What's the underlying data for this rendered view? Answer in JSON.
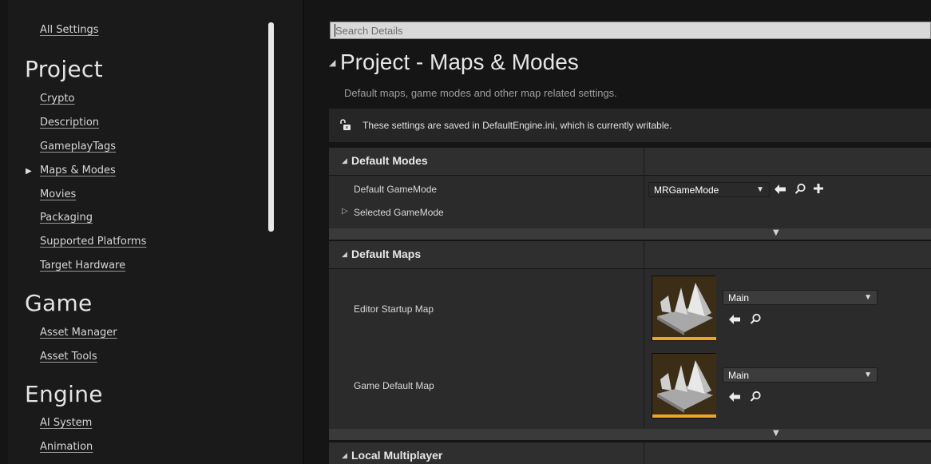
{
  "nav": {
    "top_link": "All Settings",
    "sections": [
      {
        "heading": "Project",
        "items": [
          "Crypto",
          "Description",
          "GameplayTags",
          "Maps & Modes",
          "Movies",
          "Packaging",
          "Supported Platforms",
          "Target Hardware"
        ],
        "selected": "Maps & Modes"
      },
      {
        "heading": "Game",
        "items": [
          "Asset Manager",
          "Asset Tools"
        ]
      },
      {
        "heading": "Engine",
        "items": [
          "AI System",
          "Animation"
        ]
      }
    ]
  },
  "search": {
    "placeholder": "Search Details"
  },
  "page": {
    "title": "Project - Maps & Modes",
    "description": "Default maps, game modes and other map related settings.",
    "writable_notice": "These settings are saved in DefaultEngine.ini, which is currently writable."
  },
  "categories": {
    "default_modes": {
      "label": "Default Modes",
      "props": {
        "default_gamemode": {
          "label": "Default GameMode",
          "value": "MRGameMode"
        },
        "selected_gamemode": {
          "label": "Selected GameMode"
        }
      }
    },
    "default_maps": {
      "label": "Default Maps",
      "props": {
        "editor_startup_map": {
          "label": "Editor Startup Map",
          "value": "Main"
        },
        "game_default_map": {
          "label": "Game Default Map",
          "value": "Main"
        }
      }
    },
    "local_multiplayer": {
      "label": "Local Multiplayer"
    }
  },
  "icons": {
    "dropdown": "▼",
    "collapse": "◢",
    "expand_small": "▷",
    "selected_nav": "▶",
    "use_selected": "arrow-left-icon",
    "browse": "search-icon",
    "add": "plus-icon",
    "lock": "unlocked-icon"
  },
  "colors": {
    "accent_orange": "#f0a424",
    "panel_bg": "#2b2b2b",
    "header_bg": "#2f2f2f"
  }
}
